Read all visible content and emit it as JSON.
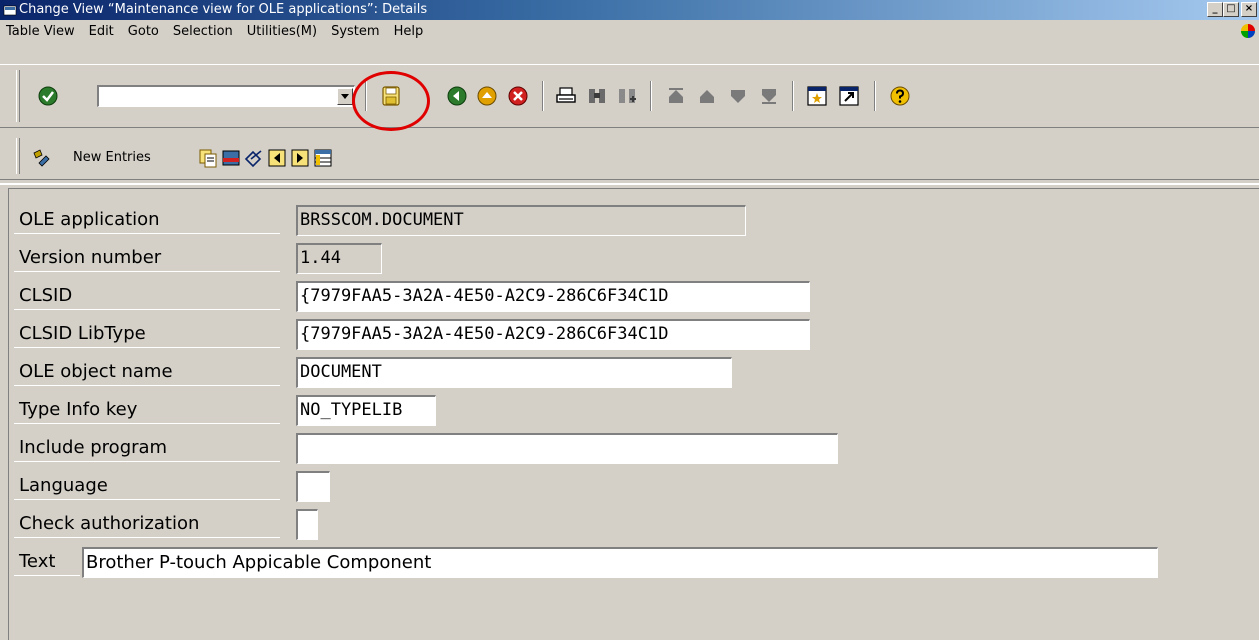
{
  "window": {
    "title": "Change View “Maintenance view for OLE applications”: Details",
    "buttons": {
      "minimize": "_",
      "maximize": "□",
      "close": "×"
    }
  },
  "menu": {
    "items": [
      "Table View",
      "Edit",
      "Goto",
      "Selection",
      "Utilities(M)",
      "System",
      "Help"
    ]
  },
  "toolbar": {
    "command_field_value": "",
    "icons": [
      "enter-icon",
      "save-icon",
      "back-icon",
      "exit-icon",
      "cancel-icon",
      "print-icon",
      "find-icon",
      "find-next-icon",
      "first-page-icon",
      "previous-page-icon",
      "next-page-icon",
      "last-page-icon",
      "create-session-icon",
      "shortcut-icon",
      "help-icon"
    ]
  },
  "app_toolbar": {
    "new_entries_label": "New Entries"
  },
  "form": {
    "ole_application": {
      "label": "OLE application",
      "value": "BRSSCOM.DOCUMENT"
    },
    "version_number": {
      "label": "Version number",
      "value": "1.44"
    },
    "clsid": {
      "label": "CLSID",
      "value": "{7979FAA5-3A2A-4E50-A2C9-286C6F34C1D"
    },
    "clsid_libtype": {
      "label": "CLSID LibType",
      "value": "{7979FAA5-3A2A-4E50-A2C9-286C6F34C1D"
    },
    "ole_object_name": {
      "label": "OLE object name",
      "value": "DOCUMENT"
    },
    "type_info_key": {
      "label": "Type Info key",
      "value": "NO_TYPELIB"
    },
    "include_program": {
      "label": "Include program",
      "value": ""
    },
    "language": {
      "label": "Language",
      "value": ""
    },
    "check_authorization": {
      "label": "Check authorization",
      "value": ""
    },
    "text": {
      "label": "Text",
      "value": "Brother P-touch Appicable Component"
    }
  },
  "colors": {
    "highlight": "#e00000",
    "title_bar": "#0a246a",
    "background": "#d4d0c8"
  }
}
